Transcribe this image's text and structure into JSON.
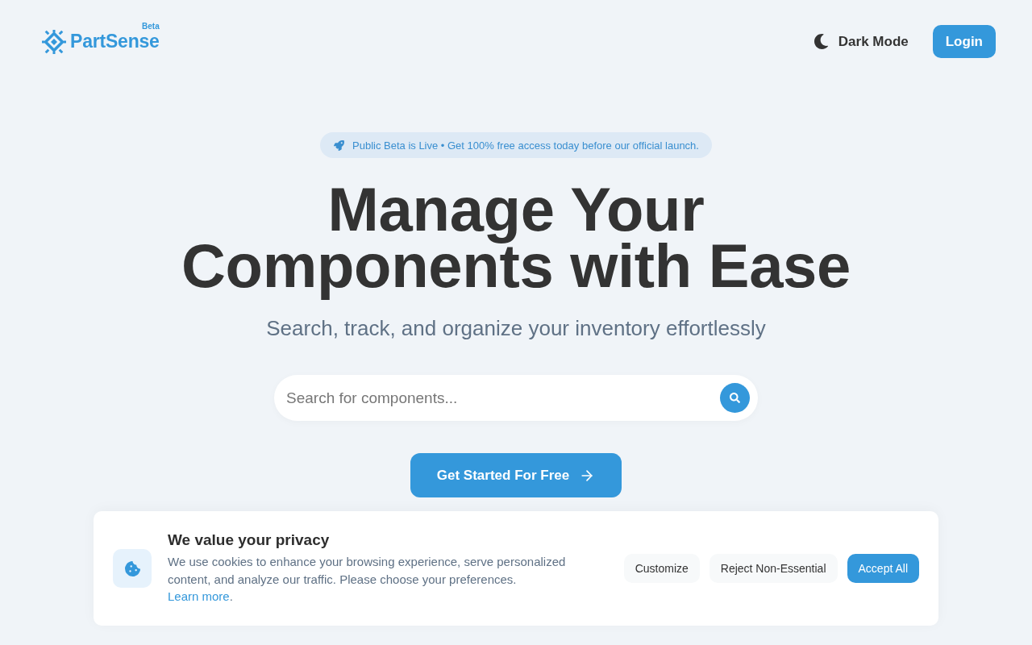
{
  "header": {
    "logo": {
      "name": "PartSense",
      "badge": "Beta"
    },
    "theme_toggle": {
      "label": "Dark Mode"
    },
    "login_button": {
      "label": "Login"
    }
  },
  "hero": {
    "announcement": "Public Beta is Live • Get 100% free access today before our official launch.",
    "title_lines": [
      "Manage Your",
      "Components with Ease"
    ],
    "subtitle": "Search, track, and organize your inventory effortlessly",
    "search": {
      "placeholder": "Search for components..."
    },
    "cta": {
      "label": "Get Started For Free"
    }
  },
  "cookie_banner": {
    "title": "We value your privacy",
    "text": "We use cookies to enhance your browsing experience, serve personalized content, and analyze our traffic. Please choose your preferences.",
    "link": "Learn more",
    "link_suffix": ".",
    "buttons": [
      {
        "label": "Customize",
        "kind": "secondary"
      },
      {
        "label": "Reject Non-Essential",
        "kind": "secondary"
      },
      {
        "label": "Accept All",
        "kind": "primary"
      }
    ]
  }
}
